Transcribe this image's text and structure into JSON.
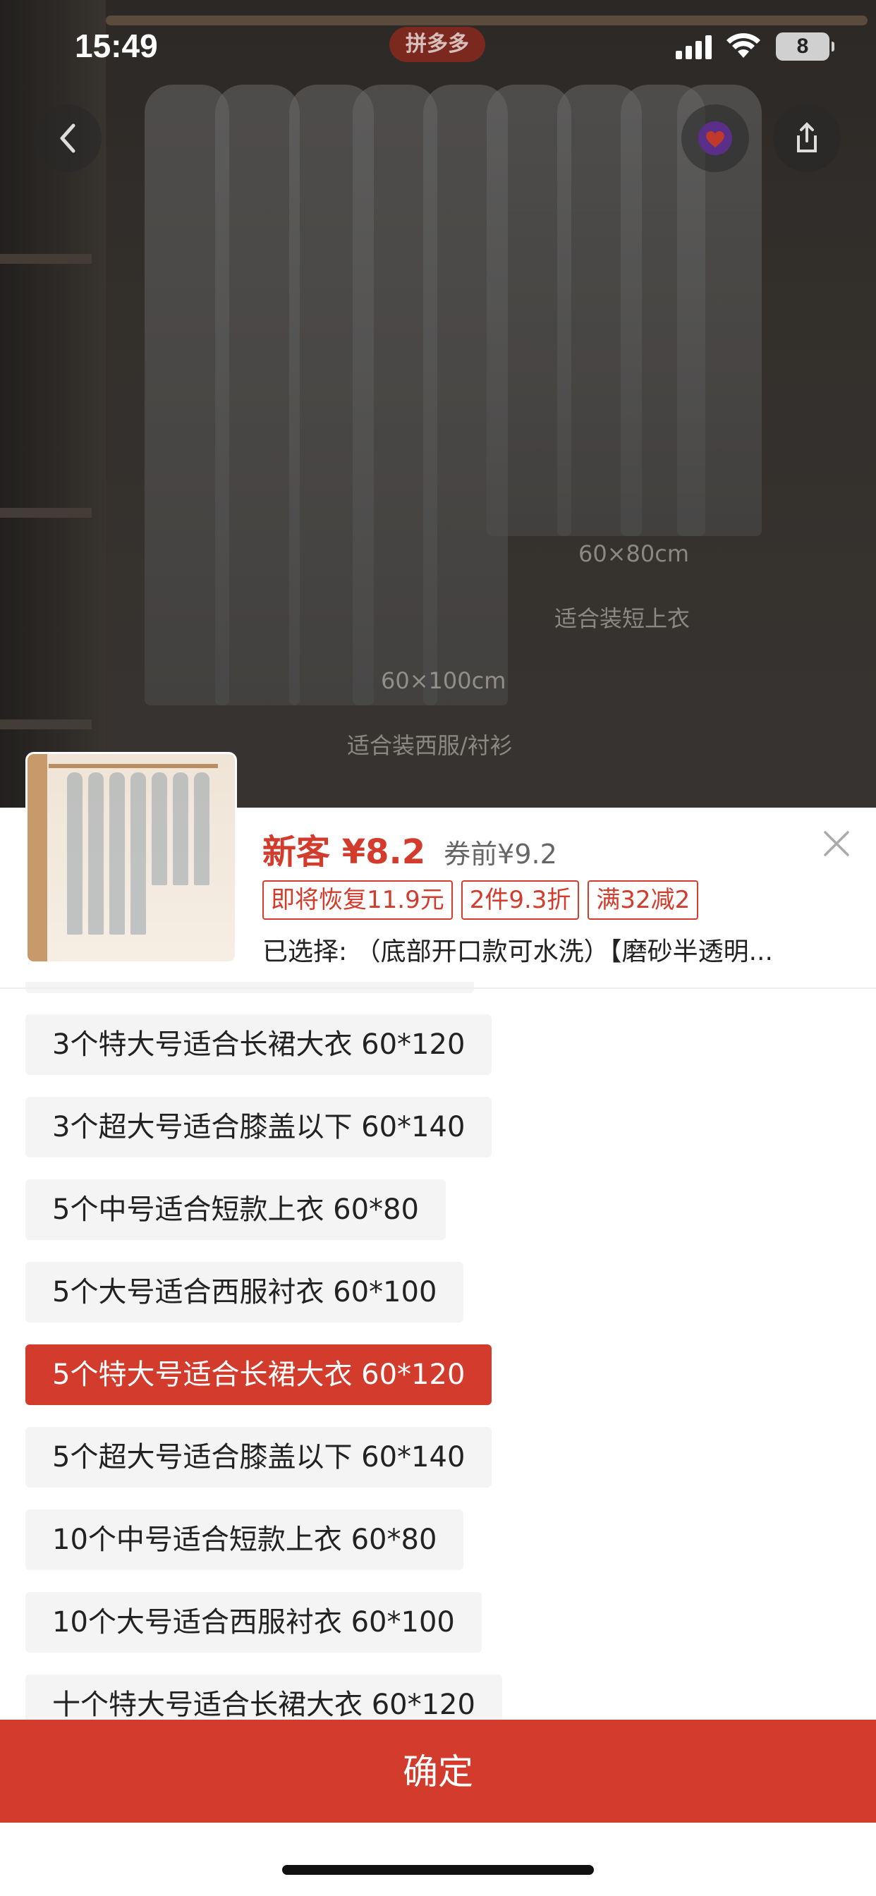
{
  "status_bar": {
    "time": "15:49",
    "app_logo": "拼多多",
    "battery": "8"
  },
  "product_image": {
    "label_short_size": "60×80cm",
    "label_short_use": "适合装短上衣",
    "label_long_size": "60×100cm",
    "label_long_use": "适合装西服/衬衫"
  },
  "sheet": {
    "price_main": "新客 ¥8.2",
    "price_before": "券前¥9.2",
    "tags": [
      "即将恢复11.9元",
      "2件9.3折",
      "满32减2"
    ],
    "selected": "已选择: （底部开口款可水洗）【磨砂半透明..."
  },
  "options": [
    {
      "label": "3个特大号适合长裙大衣 60*120",
      "selected": false
    },
    {
      "label": "3个超大号适合膝盖以下 60*140",
      "selected": false
    },
    {
      "label": "5个中号适合短款上衣 60*80",
      "selected": false
    },
    {
      "label": "5个大号适合西服衬衣 60*100",
      "selected": false
    },
    {
      "label": "5个特大号适合长裙大衣 60*120",
      "selected": true
    },
    {
      "label": "5个超大号适合膝盖以下 60*140",
      "selected": false
    },
    {
      "label": "10个中号适合短款上衣 60*80",
      "selected": false
    },
    {
      "label": "10个大号适合西服衬衣 60*100",
      "selected": false
    },
    {
      "label": "十个特大号适合长裙大衣 60*120",
      "selected": false
    }
  ],
  "confirm_label": "确定",
  "colors": {
    "accent": "#d33c2c",
    "option_bg": "#f4f4f4"
  }
}
